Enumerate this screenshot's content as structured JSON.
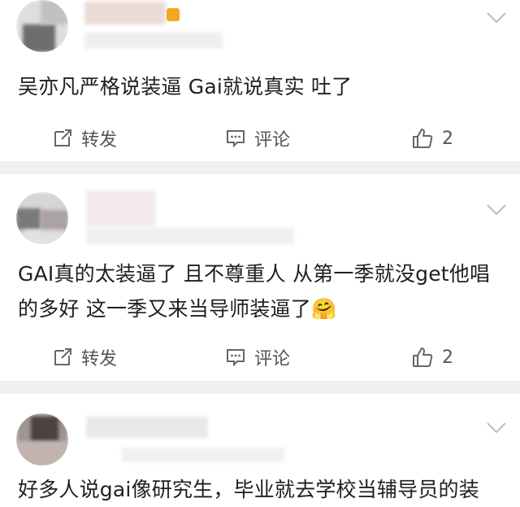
{
  "comments": [
    {
      "text": "吴亦凡严格说装逼 Gai就说真实 吐了",
      "repost_label": "转发",
      "comment_label": "评论",
      "like_count": "2"
    },
    {
      "text": "GAI真的太装逼了 且不尊重人 从第一季就没get他唱的多好 这一季又来当导师装逼了",
      "emoji": "🤗",
      "repost_label": "转发",
      "comment_label": "评论",
      "like_count": "2"
    },
    {
      "text": "好多人说gai像研究生，毕业就去学校当辅导员的装"
    }
  ],
  "colors": {
    "separator": "#f0f0f0",
    "action_text": "#555555",
    "icon": "#666666",
    "badge": "#f5a623"
  }
}
